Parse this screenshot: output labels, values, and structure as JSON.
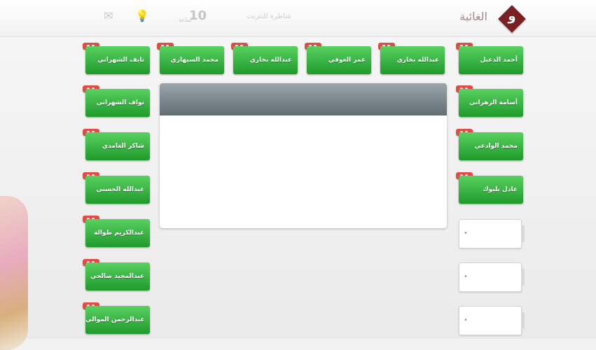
{
  "header": {
    "logo_glyph": "و",
    "title": "الغائبة",
    "tagline": "شاطرة للنترنت",
    "count": "10",
    "count_unit": "ساعة"
  },
  "panel": {
    "title": ""
  },
  "students": [
    {
      "name": "أحمد الدعيل"
    },
    {
      "name": "أسامة الزهراني"
    },
    {
      "name": "محمد الوادعي"
    },
    {
      "name": "عادل بلبوك"
    },
    {
      "name": "عبدالله بخاري"
    },
    {
      "name": "عمر العوفي"
    },
    {
      "name": "نايف الشهراني"
    },
    {
      "name": "محمد السيهاري"
    },
    {
      "name": "عبدالله بخاري"
    },
    {
      "name": "نواف الشهراني"
    },
    {
      "name": "شاكر الغامدي"
    },
    {
      "name": "عبدالله الحسني"
    },
    {
      "name": "عبدالكريم طوالة"
    },
    {
      "name": "عبدالمجيد صالحي"
    },
    {
      "name": "عبدالرحمن الموالي"
    }
  ],
  "empty_card_mark": "•",
  "colors": {
    "green_button": "#2fb33a",
    "badge_red": "#e54b45",
    "panel_header": "#6f7a81",
    "logo_diamond": "#7a1f22"
  }
}
